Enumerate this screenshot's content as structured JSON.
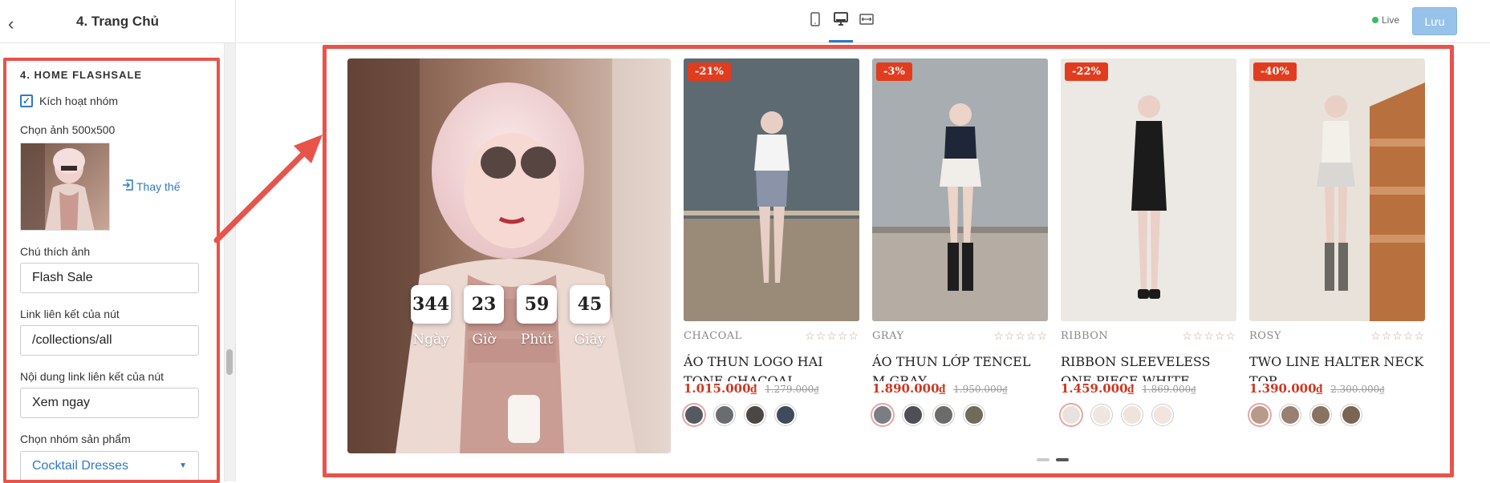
{
  "sidebar": {
    "title": "4. Trang Chủ",
    "section_title": "4. HOME FLASHSALE",
    "checkbox_label": "Kích hoạt nhóm",
    "image_label": "Chọn ảnh 500x500",
    "replace_label": "Thay thế",
    "caption_label": "Chú thích ảnh",
    "caption_value": "Flash Sale",
    "link_label": "Link liên kết của nút",
    "link_value": "/collections/all",
    "link_text_label": "Nội dung link liên kết của nút",
    "link_text_value": "Xem ngay",
    "group_label": "Chọn nhóm sản phẩm",
    "group_value": "Cocktail Dresses"
  },
  "topbar": {
    "live_label": "Live",
    "save_label": "Lưu"
  },
  "countdown": [
    {
      "value": "344",
      "label": "Ngày"
    },
    {
      "value": "23",
      "label": "Giờ"
    },
    {
      "value": "59",
      "label": "Phút"
    },
    {
      "value": "45",
      "label": "Giây"
    }
  ],
  "products": [
    {
      "discount": "-21%",
      "color": "CHACOAL",
      "name": "ÁO THUN LOGO HAI TONE CHACOAL",
      "price": "1.015.000₫",
      "old_price": "1.279.000₫",
      "stars": "☆☆☆☆☆"
    },
    {
      "discount": "-3%",
      "color": "GRAY",
      "name": "ÁO THUN LỚP Tencel M.GRAY",
      "price": "1.890.000₫",
      "old_price": "1.950.000₫",
      "stars": "☆☆☆☆☆"
    },
    {
      "discount": "-22%",
      "color": "RIBBON",
      "name": "RIBBON SLEEVELESS ONE PIECE WHITE",
      "price": "1.459.000₫",
      "old_price": "1.869.000₫",
      "stars": "☆☆☆☆☆"
    },
    {
      "discount": "-40%",
      "color": "ROSY",
      "name": "TWO LINE HALTER NECK TOP",
      "price": "1.390.000₫",
      "old_price": "2.300.000₫",
      "stars": "☆☆☆☆☆"
    }
  ],
  "colors": {
    "accent": "#2d79c7",
    "highlight": "#e8534a",
    "sale": "#d0341d",
    "save_button": "#97c3eb"
  }
}
